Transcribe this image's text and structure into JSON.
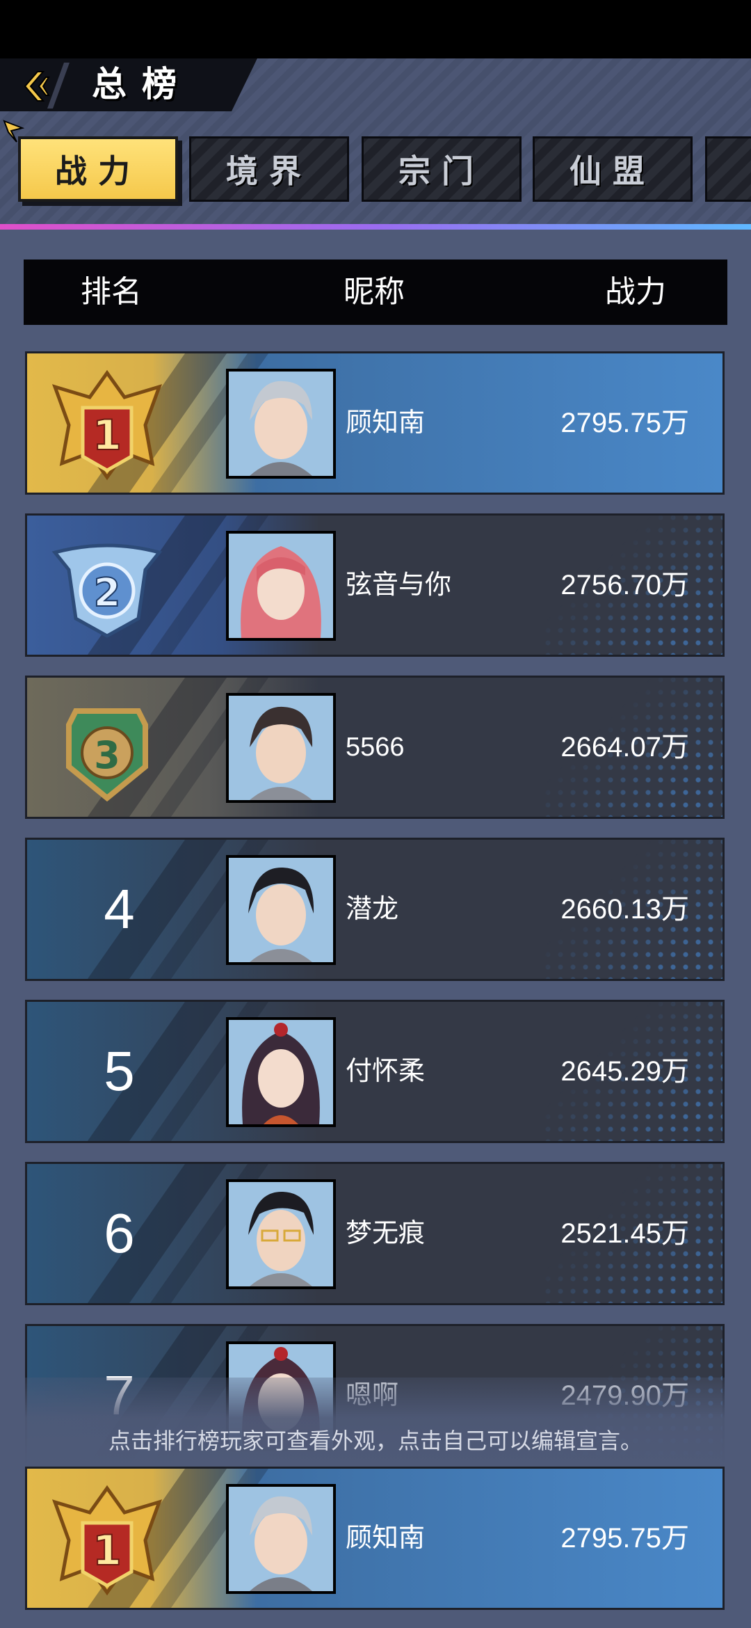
{
  "header": {
    "title": "总榜",
    "tabs": [
      "战力",
      "境界",
      "宗门",
      "仙盟"
    ],
    "active_tab": "战力"
  },
  "table": {
    "columns": [
      "排名",
      "昵称",
      "战力"
    ]
  },
  "rows": [
    {
      "rank": "1",
      "name": "顾知南",
      "power": "2795.75万",
      "badge": "gold-medal-icon"
    },
    {
      "rank": "2",
      "name": "弦音与你",
      "power": "2756.70万",
      "badge": "silver-medal-icon"
    },
    {
      "rank": "3",
      "name": "5566",
      "power": "2664.07万",
      "badge": "bronze-medal-icon"
    },
    {
      "rank": "4",
      "name": "潜龙",
      "power": "2660.13万"
    },
    {
      "rank": "5",
      "name": "付怀柔",
      "power": "2645.29万"
    },
    {
      "rank": "6",
      "name": "梦无痕",
      "power": "2521.45万"
    },
    {
      "rank": "7",
      "name": "嗯啊",
      "power": "2479.90万"
    }
  ],
  "hint": "点击排行榜玩家可查看外观，点击自己可以编辑宣言。",
  "self": {
    "rank": "1",
    "name": "顾知南",
    "power": "2795.75万"
  },
  "colors": {
    "accent_gold": "#f5c84b",
    "accent_blue": "#4a88c8",
    "tab_line": "#e04fc9"
  }
}
